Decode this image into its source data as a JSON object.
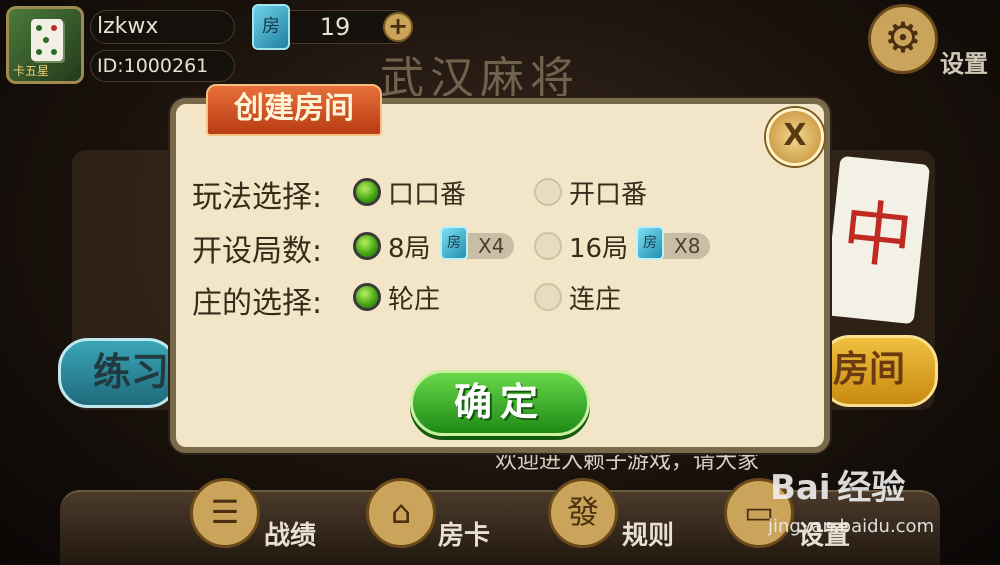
{
  "user": {
    "name": "lzkwx",
    "id_text": "ID:1000261",
    "avatar_caption": "卡五星"
  },
  "room_cards": {
    "icon_char": "房",
    "count": "19",
    "add_symbol": "+"
  },
  "game_title": "武汉麻将",
  "settings": {
    "label": "设置",
    "icon_char": "⚙"
  },
  "background": {
    "left_button_text": "练习",
    "right_button_text": "房间",
    "tile_char": "中",
    "welcome_text": "欢迎进入赖子游戏，请大家"
  },
  "bottom_nav": [
    {
      "label": "战绩",
      "icon": "☰"
    },
    {
      "label": "房卡",
      "icon": "⌂"
    },
    {
      "label": "规则",
      "icon": "發"
    },
    {
      "label": "设置",
      "icon": "▭"
    }
  ],
  "watermark": {
    "brand": "Bai 经验",
    "url": "jingyan.baidu.com"
  },
  "dialog": {
    "tab_title": "创建房间",
    "close_label": "X",
    "rows": [
      {
        "label": "玩法选择:",
        "options": [
          {
            "text": "口口番",
            "selected": true
          },
          {
            "text": "开口番",
            "selected": false
          }
        ]
      },
      {
        "label": "开设局数:",
        "options": [
          {
            "text": "8局",
            "selected": true,
            "cost": "X4"
          },
          {
            "text": "16局",
            "selected": false,
            "cost": "X8"
          }
        ]
      },
      {
        "label": "庄的选择:",
        "options": [
          {
            "text": "轮庄",
            "selected": true
          },
          {
            "text": "连庄",
            "selected": false
          }
        ]
      }
    ],
    "card_icon_char": "房",
    "confirm_label": "确定"
  }
}
